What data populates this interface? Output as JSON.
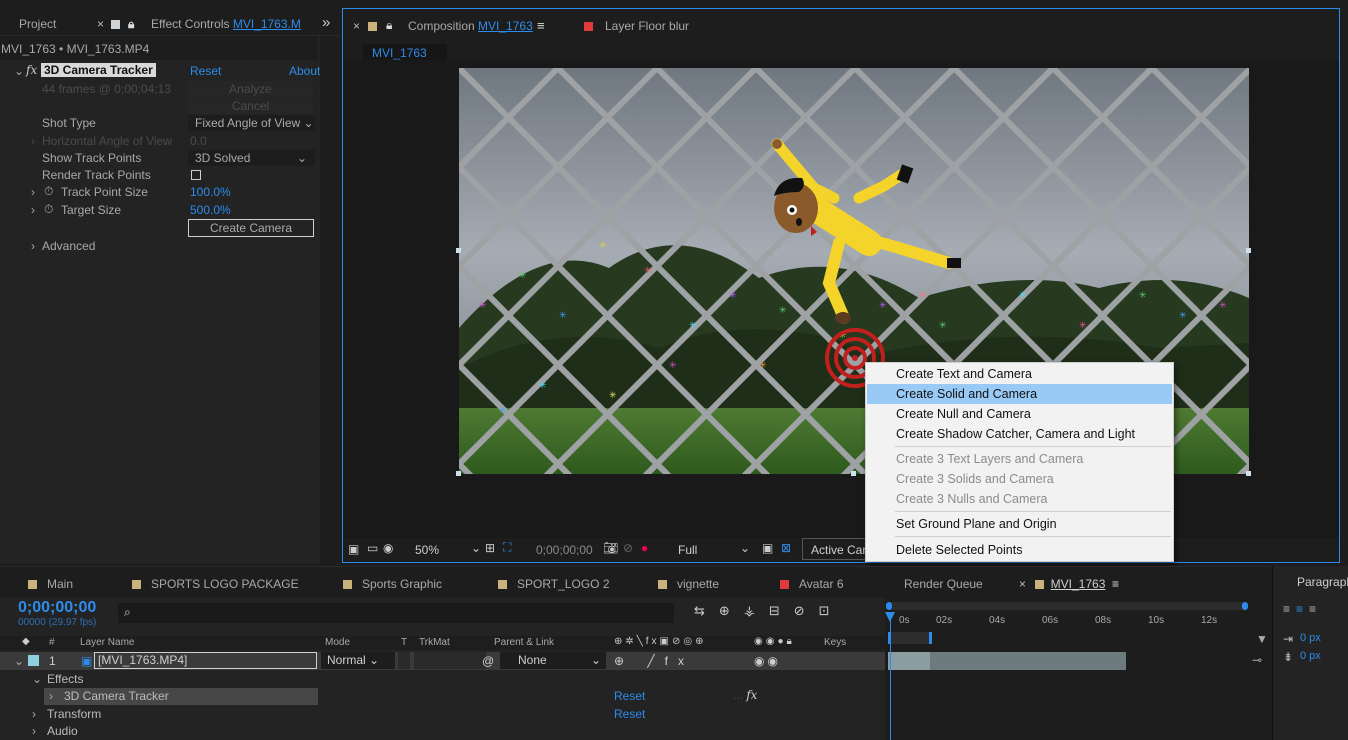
{
  "left_panel": {
    "tab_project": "Project",
    "tab_effect_controls_prefix": "Effect Controls",
    "tab_effect_controls_name": "MVI_1763.M",
    "overflow": "»",
    "breadcrumb": "MVI_1763 • MVI_1763.MP4",
    "effect_name": "3D Camera Tracker",
    "reset": "Reset",
    "about": "About",
    "frames_info": "44 frames @ 0;00;04;13",
    "analyze": "Analyze",
    "cancel": "Cancel",
    "shot_type_label": "Shot Type",
    "shot_type_value": "Fixed Angle of View",
    "horizontal_angle_label": "Horizontal Angle of View",
    "horizontal_angle_value": "0.0",
    "show_track_points_label": "Show Track Points",
    "show_track_points_value": "3D Solved",
    "render_track_points_label": "Render Track Points",
    "track_point_size_label": "Track Point Size",
    "track_point_size_value": "100.0",
    "target_size_label": "Target Size",
    "target_size_value": "500.0",
    "percent": "%",
    "create_camera": "Create Camera",
    "advanced": "Advanced"
  },
  "comp_panel": {
    "tab_comp_prefix": "Composition",
    "tab_comp_name": "MVI_1763",
    "tab_layer": "Layer  Floor blur",
    "subtab": "MVI_1763",
    "zoom": "50%",
    "timecode": "0;00;00;00",
    "resolution": "Full",
    "active_camera": "Active Cam"
  },
  "context_menu": {
    "items": [
      {
        "label": "Create Text and Camera"
      },
      {
        "label": "Create Solid and Camera"
      },
      {
        "label": "Create Null and Camera"
      },
      {
        "label": "Create Shadow Catcher, Camera and Light"
      },
      {
        "label": "Create 3 Text Layers and Camera"
      },
      {
        "label": "Create 3 Solids and Camera"
      },
      {
        "label": "Create 3 Nulls and Camera"
      },
      {
        "label": "Set Ground Plane and Origin"
      },
      {
        "label": "Delete Selected Points"
      }
    ]
  },
  "timeline": {
    "tabs": [
      "Main",
      "SPORTS LOGO PACKAGE",
      "Sports Graphic",
      "SPORT_LOGO 2",
      "vignette",
      "Avatar 6",
      "Render Queue",
      "MVI_1763"
    ],
    "tab_colors": [
      "#c9b27c",
      "#c9b27c",
      "#c9b27c",
      "#c9b27c",
      "#c9b27c",
      "#e0393e",
      "",
      "#c9b27c"
    ],
    "timecode": "0;00;00;00",
    "fps": "00000 (29.97 fps)",
    "search_icon": "search-icon",
    "col_hash": "#",
    "col_layer_name": "Layer Name",
    "col_mode": "Mode",
    "col_t": "T",
    "col_trkmat": "TrkMat",
    "col_parent": "Parent & Link",
    "col_keys": "Keys",
    "layer_num": "1",
    "layer_name": "[MVI_1763.MP4]",
    "layer_mode": "Normal",
    "layer_parent": "None",
    "effects": "Effects",
    "effect_row": "3D Camera Tracker",
    "transform": "Transform",
    "audio": "Audio",
    "reset": "Reset",
    "fx": "fx",
    "ruler": [
      "0s",
      "02s",
      "04s",
      "06s",
      "08s",
      "10s",
      "12s"
    ]
  },
  "paragraph_panel": {
    "title": "Paragraph",
    "indent_value": "0 px",
    "space_value": "0 px"
  }
}
